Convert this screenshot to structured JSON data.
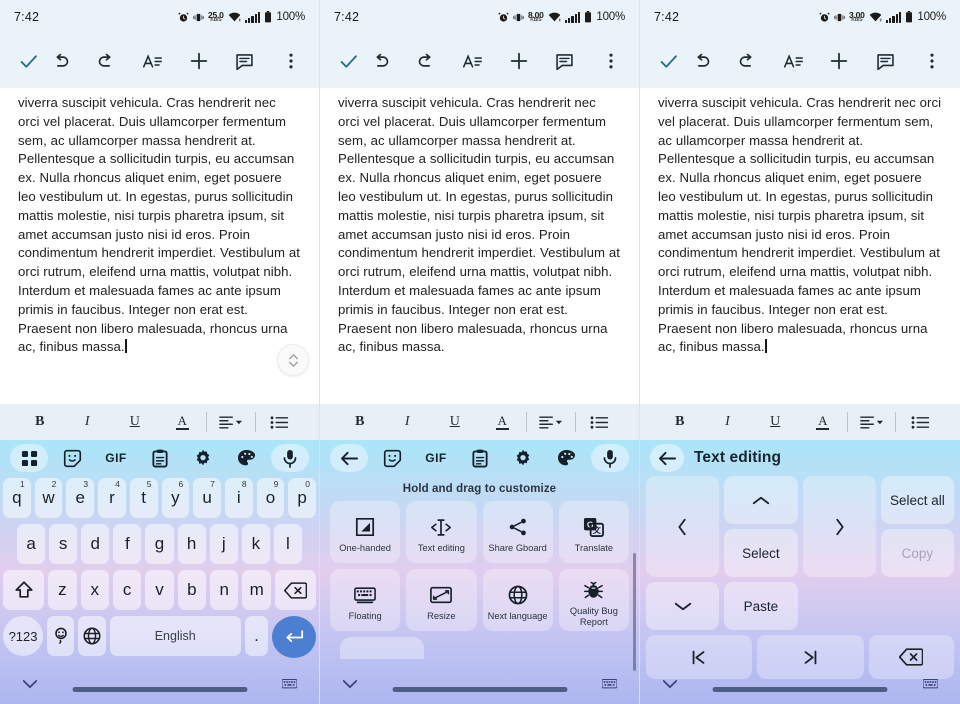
{
  "panels": [
    {
      "status": {
        "time": "7:42",
        "data_rate": "25.0",
        "data_unit": "KB/S",
        "battery": "100%"
      },
      "keyboard_mode": "qwerty"
    },
    {
      "status": {
        "time": "7:42",
        "data_rate": "8.00",
        "data_unit": "KB/S",
        "battery": "100%"
      },
      "keyboard_mode": "customize-menu"
    },
    {
      "status": {
        "time": "7:42",
        "data_rate": "3.00",
        "data_unit": "KB/S",
        "battery": "100%"
      },
      "keyboard_mode": "text-editing"
    }
  ],
  "toolbar": {
    "done_label": "done-check",
    "undo_label": "undo",
    "redo_label": "redo",
    "format_label": "text-format",
    "insert_label": "insert",
    "comment_label": "comment",
    "more_label": "more-options"
  },
  "document": {
    "text": "viverra suscipit vehicula. Cras hendrerit nec orci vel placerat. Duis ullamcorper fermentum sem, ac ullamcorper massa hendrerit at. Pellentesque a sollicitudin turpis, eu accumsan ex. Nulla rhoncus aliquet enim, eget posuere leo vestibulum ut. In egestas, purus sollicitudin mattis molestie, nisi turpis pharetra ipsum, sit amet accumsan justo nisi id eros. Proin condimentum hendrerit imperdiet. Vestibulum at orci rutrum, eleifend urna mattis, volutpat nibh. Interdum et malesuada fames ac ante ipsum primis in faucibus. Integer non erat est. Praesent non libero malesuada, rhoncus urna ac, finibus massa."
  },
  "format_toolbar": {
    "bold": "B",
    "italic": "I",
    "underline": "U",
    "text_color": "A",
    "align": "align-left",
    "list": "bulleted-list"
  },
  "keyboard_toolbar": {
    "items": [
      {
        "name": "apps-grid-icon",
        "label": "apps"
      },
      {
        "name": "sticker-icon",
        "label": "stickers"
      },
      {
        "name": "gif-icon",
        "label": "GIF"
      },
      {
        "name": "clipboard-icon",
        "label": "clipboard"
      },
      {
        "name": "gear-icon",
        "label": "settings"
      },
      {
        "name": "palette-icon",
        "label": "theme"
      },
      {
        "name": "microphone-icon",
        "label": "voice input"
      }
    ],
    "back_label": "back"
  },
  "qwerty": {
    "row1": [
      {
        "key": "q",
        "num": "1"
      },
      {
        "key": "w",
        "num": "2"
      },
      {
        "key": "e",
        "num": "3"
      },
      {
        "key": "r",
        "num": "4"
      },
      {
        "key": "t",
        "num": "5"
      },
      {
        "key": "y",
        "num": "6"
      },
      {
        "key": "u",
        "num": "7"
      },
      {
        "key": "i",
        "num": "8"
      },
      {
        "key": "o",
        "num": "9"
      },
      {
        "key": "p",
        "num": "0"
      }
    ],
    "row2": [
      "a",
      "s",
      "d",
      "f",
      "g",
      "h",
      "j",
      "k",
      "l"
    ],
    "row3": [
      "z",
      "x",
      "c",
      "v",
      "b",
      "n",
      "m"
    ],
    "shift": "shift",
    "backspace": "backspace",
    "symbols": "?123",
    "emoji": "emoji",
    "globe": "globe",
    "space": "English",
    "period": ".",
    "enter": "enter"
  },
  "customize_menu": {
    "header": "Hold and drag to customize",
    "items": [
      {
        "label": "One-handed",
        "icon": "one-handed-icon"
      },
      {
        "label": "Text editing",
        "icon": "text-editing-icon"
      },
      {
        "label": "Share Gboard",
        "icon": "share-icon"
      },
      {
        "label": "Translate",
        "icon": "translate-icon"
      },
      {
        "label": "Floating",
        "icon": "floating-keyboard-icon"
      },
      {
        "label": "Resize",
        "icon": "resize-icon"
      },
      {
        "label": "Next language",
        "icon": "globe-icon"
      },
      {
        "label": "Quality Bug Report",
        "icon": "bug-icon"
      }
    ]
  },
  "text_editing": {
    "title": "Text editing",
    "select_all": "Select all",
    "copy": "Copy",
    "copy_disabled": true,
    "paste": "Paste",
    "select": "Select",
    "up": "move-up",
    "down": "move-down",
    "left": "move-left",
    "right": "move-right",
    "start": "jump-to-start",
    "end": "jump-to-end",
    "backspace": "backspace"
  },
  "navbar": {
    "hide_keyboard": "hide-keyboard",
    "switch_keyboard": "switch-keyboard",
    "home_indicator": "home-indicator"
  },
  "colors": {
    "toolbar_bg": "#eaf3f9",
    "accent_check": "#2a6f7f",
    "enter_key": "#4c7fd1",
    "format_bar_bg": "#e8eff5"
  }
}
